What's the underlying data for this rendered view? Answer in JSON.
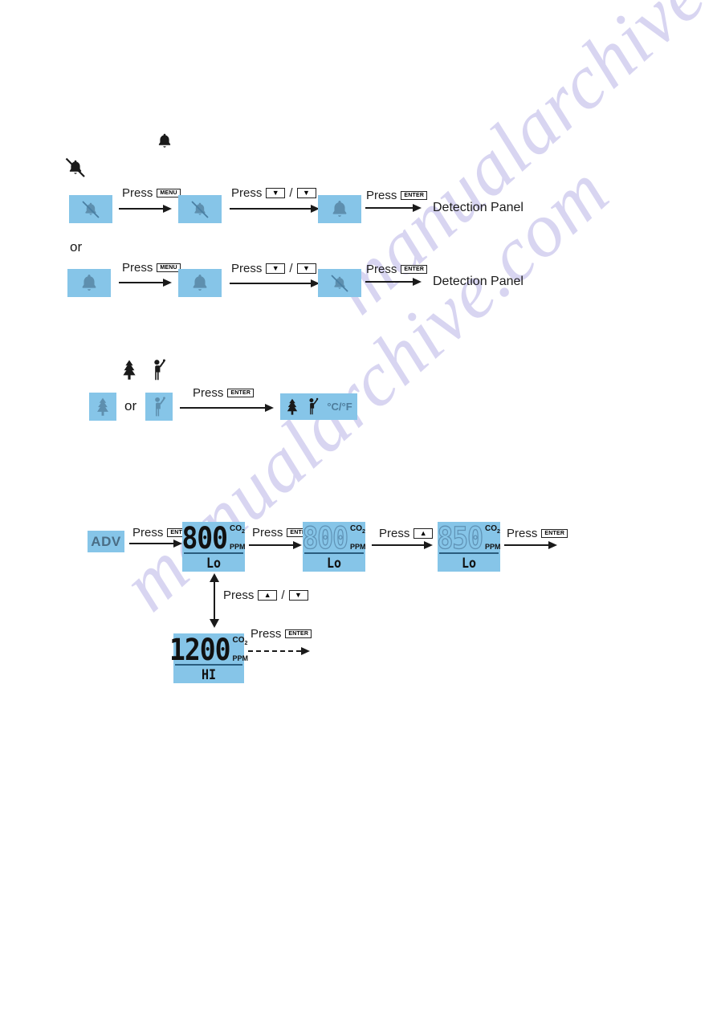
{
  "document": {
    "type": "instruction-diagram",
    "colors": {
      "lcd_blue": "#86c5e8",
      "ink": "#1a1a1a",
      "lcd_icon_blue": "#5e8fae",
      "watermark": "#b9b4e6"
    },
    "watermark": {
      "line1": "manualarchive.com",
      "line2": "manualarchive.com"
    }
  },
  "legend_icons": {
    "bell_on": "bell-icon",
    "bell_off": "bell-muted-icon"
  },
  "flow_alarm": {
    "or_label": "or",
    "row1": {
      "steps": [
        {
          "icon": "bell-muted-icon",
          "state": "off"
        },
        {
          "icon": "bell-muted-icon",
          "state": "off"
        },
        {
          "icon": "bell-icon",
          "state": "on"
        }
      ],
      "transitions": [
        {
          "press_label": "Press",
          "keys": [
            "MENU"
          ]
        },
        {
          "press_label": "Press",
          "keys": [
            "▼",
            "▼"
          ],
          "separator": "/"
        },
        {
          "press_label": "Press",
          "keys": [
            "ENTER"
          ]
        }
      ],
      "result": "Detection Panel"
    },
    "row2": {
      "steps": [
        {
          "icon": "bell-icon",
          "state": "on"
        },
        {
          "icon": "bell-icon",
          "state": "on"
        },
        {
          "icon": "bell-muted-icon",
          "state": "off"
        }
      ],
      "transitions": [
        {
          "press_label": "Press",
          "keys": [
            "MENU"
          ]
        },
        {
          "press_label": "Press",
          "keys": [
            "▼",
            "▼"
          ],
          "separator": "/"
        },
        {
          "press_label": "Press",
          "keys": [
            "ENTER"
          ]
        }
      ],
      "result": "Detection Panel"
    }
  },
  "flow_mode": {
    "legend": [
      "tree-icon",
      "person-icon"
    ],
    "option_a": {
      "icon": "tree-icon"
    },
    "or_label": "or",
    "option_b": {
      "icon": "person-icon"
    },
    "transition": {
      "press_label": "Press",
      "keys": [
        "ENTER"
      ]
    },
    "result_tile": {
      "icons": [
        "tree-icon",
        "person-icon"
      ],
      "unit_label": "°C/°F"
    }
  },
  "flow_co2": {
    "start_badge": "ADV",
    "transitions": [
      {
        "press_label": "Press",
        "keys": [
          "ENTER"
        ]
      },
      {
        "press_label": "Press",
        "keys": [
          "ENTER"
        ]
      },
      {
        "press_label": "Press",
        "keys": [
          "▲"
        ]
      },
      {
        "press_label": "Press",
        "keys": [
          "ENTER"
        ]
      }
    ],
    "toggle": {
      "press_label": "Press",
      "keys": [
        "▲",
        "▼"
      ],
      "separator": "/"
    },
    "final_transition": {
      "press_label": "Press",
      "keys": [
        "ENTER"
      ],
      "style": "dashed"
    },
    "displays": [
      {
        "value": "800",
        "gas": "CO",
        "gas_sub": "2",
        "unit": "PPM",
        "level": "Lo",
        "blinking": false
      },
      {
        "value": "800",
        "gas": "CO",
        "gas_sub": "2",
        "unit": "PPM",
        "level": "Lo",
        "blinking": true
      },
      {
        "value": "850",
        "gas": "CO",
        "gas_sub": "2",
        "unit": "PPM",
        "level": "Lo",
        "blinking": true
      },
      {
        "value": "1200",
        "gas": "CO",
        "gas_sub": "2",
        "unit": "PPM",
        "level": "HI",
        "blinking": false
      }
    ]
  }
}
